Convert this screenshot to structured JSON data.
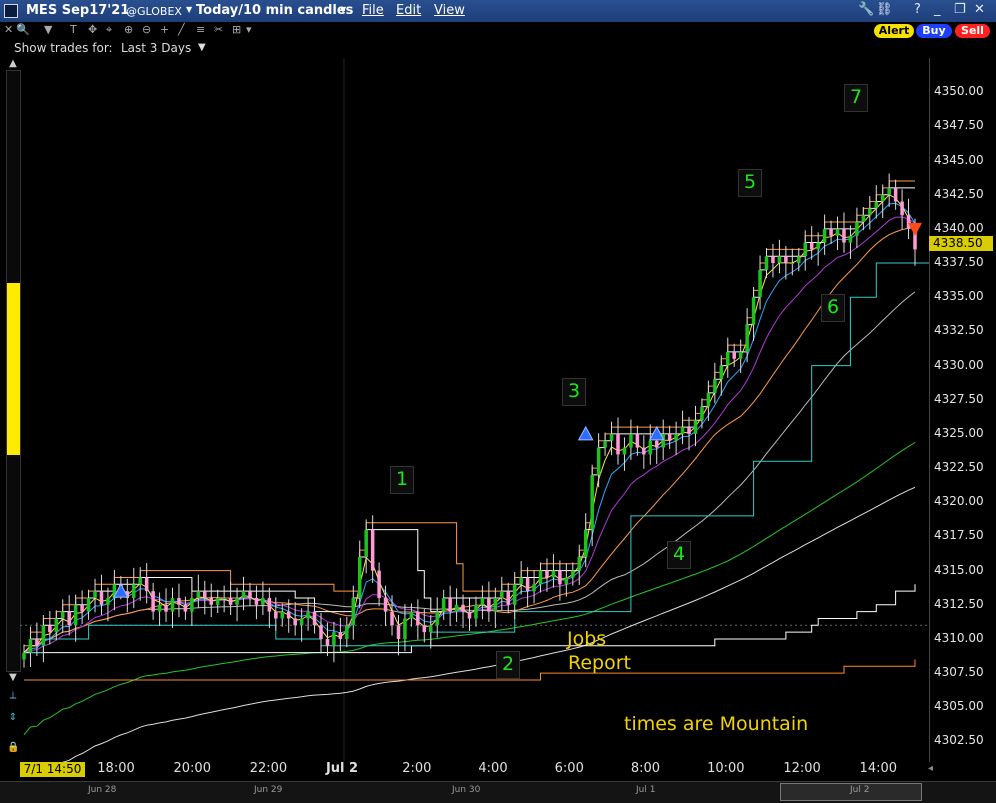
{
  "titlebar": {
    "symbol": "MES Sep17'21",
    "exchange": "@GLOBEX",
    "period": "Today/10 min candles",
    "menu": [
      "File",
      "Edit",
      "View"
    ],
    "buttons": {
      "alert": "Alert",
      "buy": "Buy",
      "sell": "Sell"
    }
  },
  "showbar": {
    "label": "Show trades for:",
    "value": "Last 3 Days"
  },
  "y_axis": {
    "labels": [
      "4350.00",
      "4347.50",
      "4345.00",
      "4342.50",
      "4340.00",
      "4337.50",
      "4335.00",
      "4332.50",
      "4330.00",
      "4327.50",
      "4325.00",
      "4322.50",
      "4320.00",
      "4317.50",
      "4315.00",
      "4312.50",
      "4310.00",
      "4307.50",
      "4305.00",
      "4302.50"
    ],
    "current_price": "4338.50"
  },
  "x_axis": {
    "start_marker": "7/1 14:50",
    "labels": [
      "18:00",
      "20:00",
      "22:00",
      "Jul 2",
      "2:00",
      "4:00",
      "6:00",
      "8:00",
      "10:00",
      "12:00",
      "14:00"
    ],
    "nav_labels": [
      "Jun 28",
      "Jun 29",
      "Jun 30",
      "Jul 1",
      "Jul 2"
    ]
  },
  "annotations": {
    "numbers": [
      "1",
      "2",
      "3",
      "4",
      "5",
      "6",
      "7"
    ],
    "jobs_line1": "Jobs",
    "jobs_line2": "Report",
    "timezone_note": "times are Mountain"
  },
  "colors": {
    "background": "#000000",
    "up_candle": "#1fbf1f",
    "down_candle": "#ff9ad5",
    "cyan_band": "#33cccc",
    "orange_band": "#ff9a4a",
    "blue_ma": "#2aa8ff",
    "yellow_ma": "#ffe24d",
    "purple_ma": "#b03ad6",
    "accent_yellow": "#d9cc00",
    "annotation_green": "#1ee61e"
  },
  "chart_data": {
    "type": "candlestick",
    "ylim": [
      4301,
      4352.5
    ],
    "x_range_hours": [
      15.5,
      39.35
    ],
    "x_unit": "hours since Jul 1 00:00 (Mountain)",
    "closes": [
      4309,
      4310,
      4309.5,
      4311,
      4310.5,
      4311.5,
      4312,
      4311,
      4312.5,
      4312,
      4313,
      4313.5,
      4312.5,
      4313,
      4314,
      4313.5,
      4313,
      4314,
      4314.5,
      4313.5,
      4312,
      4312.5,
      4312,
      4313,
      4312.5,
      4312,
      4313,
      4313.5,
      4313,
      4312.5,
      4313,
      4313,
      4312.5,
      4313,
      4313.5,
      4313,
      4312.5,
      4313,
      4312,
      4311.5,
      4312,
      4311.5,
      4311,
      4311.5,
      4312,
      4311,
      4310,
      4309.5,
      4310.5,
      4310,
      4311,
      4313,
      4316,
      4318,
      4315,
      4313,
      4312,
      4311,
      4310,
      4311.5,
      4312,
      4311,
      4310.5,
      4311,
      4312,
      4313,
      4312,
      4312.5,
      4312,
      4311.5,
      4312.5,
      4313,
      4312,
      4313,
      4313.5,
      4312.5,
      4314,
      4314.5,
      4313.5,
      4314,
      4315,
      4314.5,
      4315,
      4314,
      4314.5,
      4315,
      4316,
      4318,
      4322,
      4324,
      4324.5,
      4325,
      4323.5,
      4324,
      4325,
      4324,
      4323.5,
      4324.5,
      4324,
      4325,
      4324.5,
      4325,
      4325.5,
      4325,
      4326,
      4327,
      4328,
      4329,
      4330,
      4331,
      4330.5,
      4331,
      4333,
      4335,
      4337,
      4338,
      4337.5,
      4338,
      4337.5,
      4337.5,
      4338,
      4339,
      4338.5,
      4339,
      4340,
      4339.5,
      4340,
      4339,
      4339.5,
      4340.5,
      4341,
      4341.5,
      4342,
      4342.5,
      4343,
      4342,
      4341,
      4340,
      4338.5
    ],
    "series": [
      {
        "type": "cyan_band_low",
        "values": [
          4309,
          4309,
          4309,
          4310,
          4310,
          4310,
          4310,
          4310,
          4310,
          4310,
          4311,
          4311,
          4311,
          4311,
          4311,
          4311,
          4311,
          4311,
          4311,
          4311,
          4311,
          4311,
          4311,
          4311,
          4311,
          4311,
          4311,
          4311,
          4311,
          4311,
          4311,
          4311,
          4311,
          4311,
          4311,
          4311,
          4311,
          4311,
          4311,
          4310,
          4310,
          4310,
          4310,
          4310,
          4310,
          4310,
          4309.5,
          4309.5,
          4309.5,
          4309.5,
          4309.5,
          4309.5,
          4309.5,
          4309.5,
          4309.5,
          4309.5,
          4309.5,
          4309.5,
          4309.5,
          4309.5,
          4309.5,
          4309.5,
          4309.5,
          4310.5,
          4310.5,
          4310.5,
          4310.5,
          4310.5,
          4310.5,
          4310.5,
          4310.5,
          4310.5,
          4310.5,
          4310.5,
          4310.5,
          4310.5,
          4312,
          4312,
          4312,
          4312,
          4312,
          4312,
          4312,
          4312,
          4312,
          4312,
          4312,
          4312,
          4312,
          4312,
          4312,
          4312,
          4312,
          4312,
          4319,
          4319,
          4319,
          4319,
          4319,
          4319,
          4319,
          4319,
          4319,
          4319,
          4319,
          4319,
          4319,
          4319,
          4319,
          4319,
          4319,
          4319,
          4319,
          4323,
          4323,
          4323,
          4323,
          4323,
          4323,
          4323,
          4323,
          4323,
          4330,
          4330,
          4330,
          4330,
          4330,
          4330,
          4335,
          4335,
          4335,
          4335,
          4337.5,
          4337.5,
          4337.5,
          4337.5,
          4337.5,
          4337.5,
          4337.5,
          4337.5,
          4337.5,
          4337.5
        ]
      }
    ]
  }
}
